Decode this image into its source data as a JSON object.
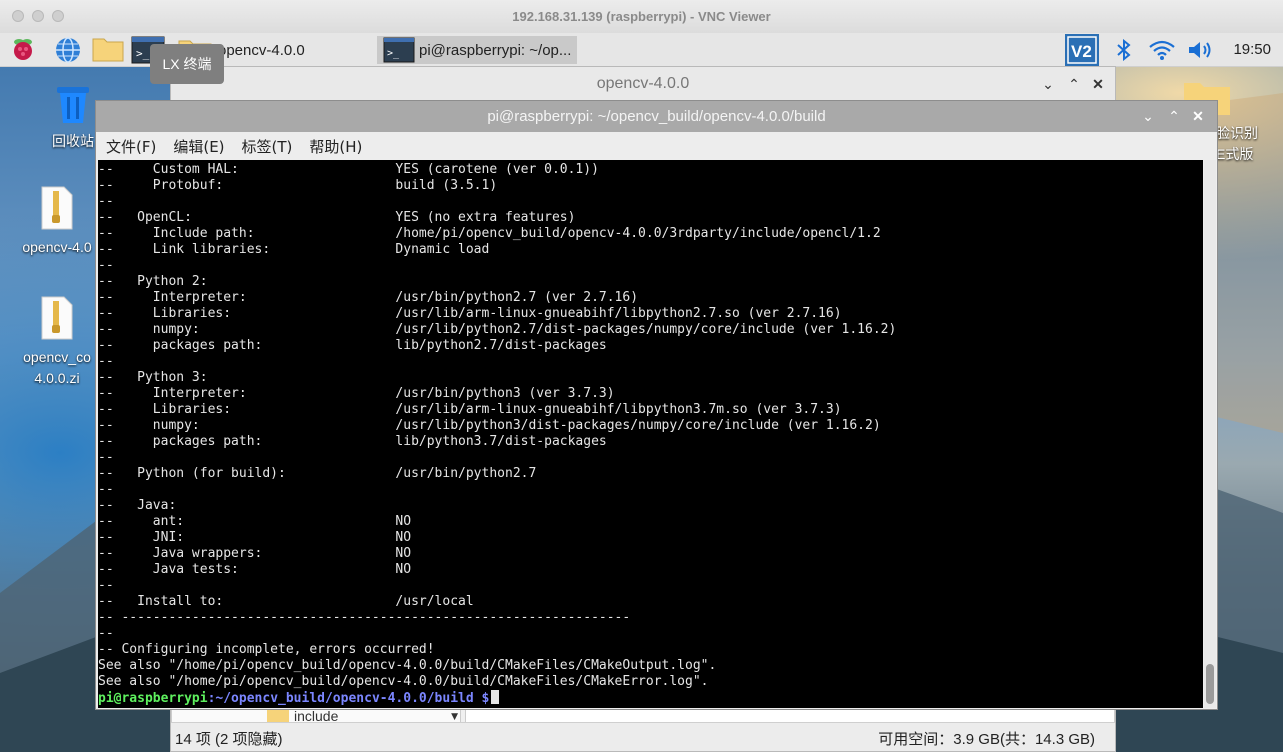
{
  "vnc": {
    "title": "192.168.31.139 (raspberrypi) - VNC Viewer"
  },
  "panel": {
    "tasks": [
      {
        "label": "opencv-4.0.0"
      },
      {
        "label": "pi@raspberrypi: ~/op..."
      }
    ],
    "clock": "19:50",
    "tooltip": "LX 终端",
    "tray_icons": [
      "vnc-icon",
      "bluetooth-icon",
      "wifi-icon",
      "volume-icon"
    ]
  },
  "desktop": {
    "icons": [
      {
        "label": "回收站",
        "icon": "trash-icon"
      },
      {
        "label": "opencv-4.0",
        "icon": "zip-file-icon"
      },
      {
        "label_line1": "opencv_co",
        "label_line2": "4.0.0.zi",
        "icon": "zip-file-icon"
      },
      {
        "label_line1": "脸识别",
        "label_line2": "E式版",
        "icon": "folder-icon"
      }
    ]
  },
  "file_manager": {
    "title": "opencv-4.0.0",
    "row_label": "include",
    "status_left": "14 项 (2 项隐藏)",
    "status_right": "可用空间：3.9 GB(共：14.3 GB)"
  },
  "terminal": {
    "title": "pi@raspberrypi: ~/opencv_build/opencv-4.0.0/build",
    "menu": [
      "文件(F)",
      "编辑(E)",
      "标签(T)",
      "帮助(H)"
    ],
    "lines": [
      "--     Custom HAL:                    YES (carotene (ver 0.0.1))",
      "--     Protobuf:                      build (3.5.1)",
      "--",
      "--   OpenCL:                          YES (no extra features)",
      "--     Include path:                  /home/pi/opencv_build/opencv-4.0.0/3rdparty/include/opencl/1.2",
      "--     Link libraries:                Dynamic load",
      "--",
      "--   Python 2:",
      "--     Interpreter:                   /usr/bin/python2.7 (ver 2.7.16)",
      "--     Libraries:                     /usr/lib/arm-linux-gnueabihf/libpython2.7.so (ver 2.7.16)",
      "--     numpy:                         /usr/lib/python2.7/dist-packages/numpy/core/include (ver 1.16.2)",
      "--     packages path:                 lib/python2.7/dist-packages",
      "--",
      "--   Python 3:",
      "--     Interpreter:                   /usr/bin/python3 (ver 3.7.3)",
      "--     Libraries:                     /usr/lib/arm-linux-gnueabihf/libpython3.7m.so (ver 3.7.3)",
      "--     numpy:                         /usr/lib/python3/dist-packages/numpy/core/include (ver 1.16.2)",
      "--     packages path:                 lib/python3.7/dist-packages",
      "--",
      "--   Python (for build):              /usr/bin/python2.7",
      "--",
      "--   Java:",
      "--     ant:                           NO",
      "--     JNI:                           NO",
      "--     Java wrappers:                 NO",
      "--     Java tests:                    NO",
      "--",
      "--   Install to:                      /usr/local",
      "-- -----------------------------------------------------------------",
      "--",
      "-- Configuring incomplete, errors occurred!",
      "See also \"/home/pi/opencv_build/opencv-4.0.0/build/CMakeFiles/CMakeOutput.log\".",
      "See also \"/home/pi/opencv_build/opencv-4.0.0/build/CMakeFiles/CMakeError.log\"."
    ],
    "prompt_user": "pi@raspberrypi",
    "prompt_path": ":~/opencv_build/opencv-4.0.0/build $"
  }
}
